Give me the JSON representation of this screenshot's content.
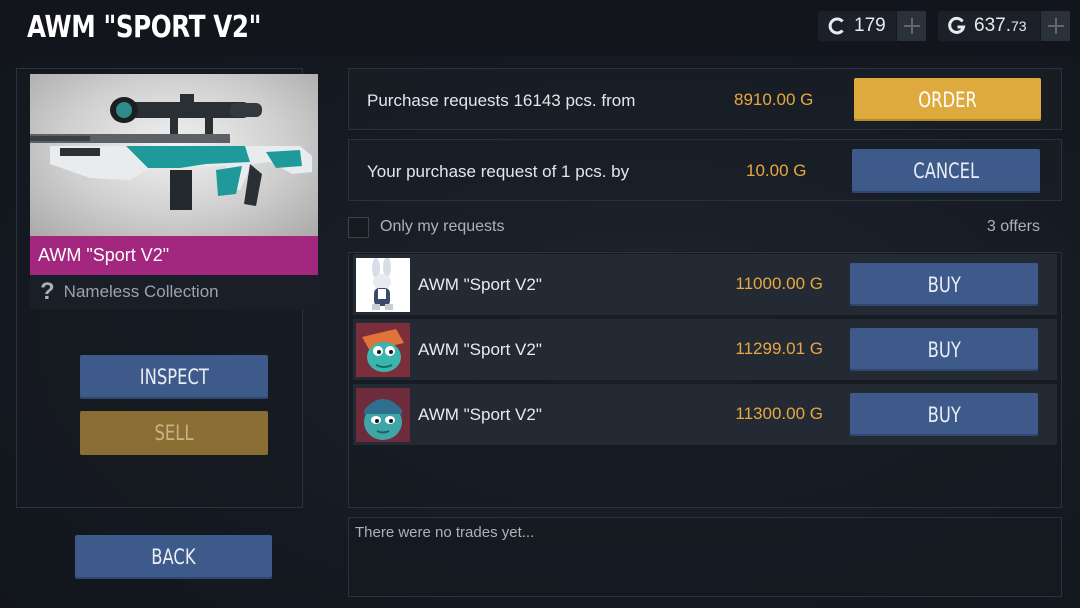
{
  "header": {
    "title": "AWM \"SPORT V2\""
  },
  "wallet": {
    "silver": {
      "icon": "silver-coin-icon",
      "value": "179"
    },
    "gold": {
      "icon": "gold-coin-icon",
      "value_main": "637.",
      "value_small": "73"
    }
  },
  "item": {
    "name": "AWM \"Sport V2\"",
    "collection": "Nameless Collection",
    "rarity_color": "#a3267f"
  },
  "actions": {
    "inspect": "INSPECT",
    "sell": "SELL",
    "back": "BACK"
  },
  "market": {
    "purchase_requests": {
      "label": "Purchase requests 16143 pcs. from",
      "price": "8910.00 G",
      "button": "ORDER"
    },
    "my_request": {
      "label": "Your purchase request of 1 pcs. by",
      "price": "10.00 G",
      "button": "CANCEL"
    },
    "filter_label": "Only my requests",
    "offers_count": "3 offers",
    "offers": [
      {
        "name": "AWM \"Sport V2\"",
        "price": "11000.00 G",
        "button": "BUY"
      },
      {
        "name": "AWM \"Sport V2\"",
        "price": "11299.01 G",
        "button": "BUY"
      },
      {
        "name": "AWM \"Sport V2\"",
        "price": "11300.00 G",
        "button": "BUY"
      }
    ],
    "trades_log": "There were no trades yet..."
  },
  "colors": {
    "accent_gold": "#deaa3d",
    "button_blue": "#3d5a8a",
    "price_orange": "#e8a740"
  }
}
